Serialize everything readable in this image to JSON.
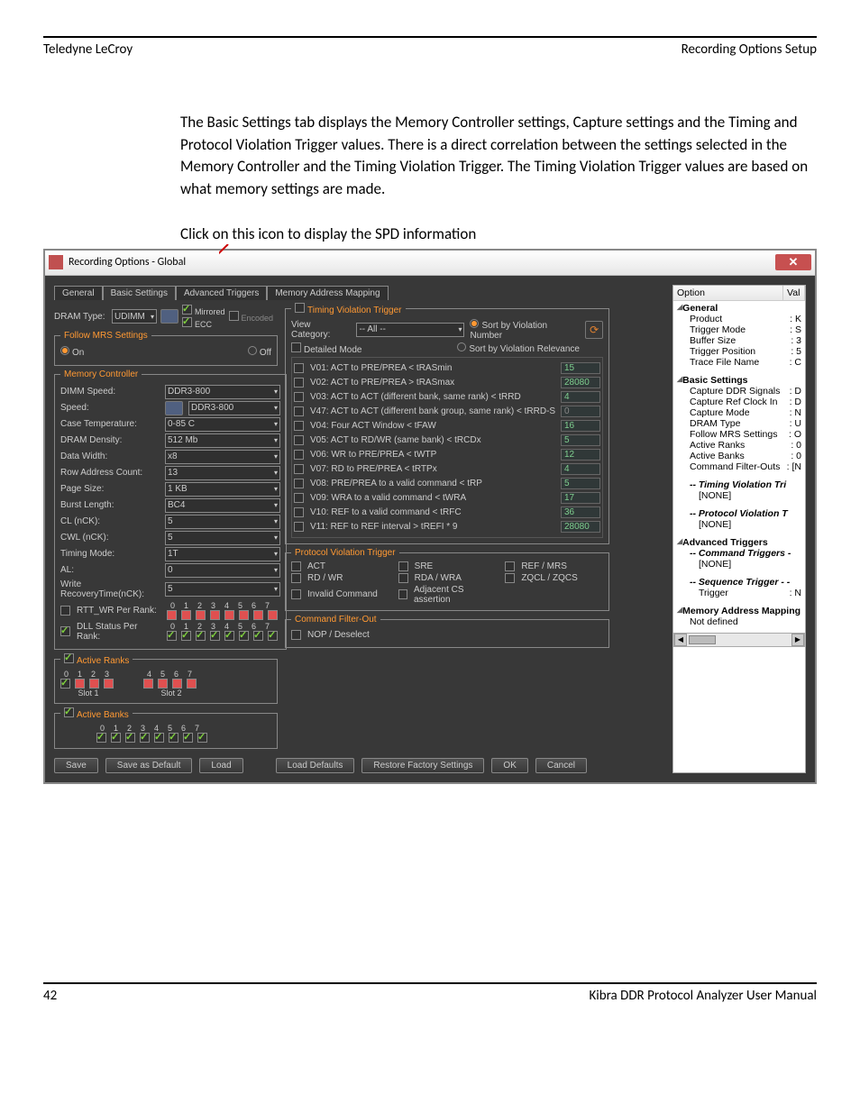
{
  "header": {
    "left": "Teledyne LeCroy",
    "right": "Recording Options Setup"
  },
  "footer": {
    "left": "42",
    "right": "Kibra DDR Protocol Analyzer User Manual"
  },
  "para": "The Basic Settings tab displays the Memory Controller settings, Capture settings and the Timing and Protocol Violation Trigger values. There is a direct correlation between the settings selected in the Memory Controller and the Timing Violation Trigger. The Timing Violation Trigger values are based on what memory settings are made.",
  "caption": "Click on this icon to display the SPD information",
  "window": {
    "title": "Recording Options - Global"
  },
  "tabs": [
    "General",
    "Basic Settings",
    "Advanced Triggers",
    "Memory Address Mapping"
  ],
  "dram": {
    "label": "DRAM Type:",
    "value": "UDIMM",
    "opts": {
      "mirrored": "Mirrored",
      "ecc": "ECC",
      "encoded": "Encoded"
    }
  },
  "mrs": {
    "legend": "Follow MRS Settings",
    "on": "On",
    "off": "Off"
  },
  "mem": {
    "legend": "Memory Controller",
    "fields": [
      {
        "label": "DIMM Speed:",
        "value": "DDR3-800"
      },
      {
        "label": "Speed:",
        "value": "DDR3-800",
        "hasicon": true
      },
      {
        "label": "Case Temperature:",
        "value": "0-85 C"
      },
      {
        "label": "DRAM Density:",
        "value": "512 Mb"
      },
      {
        "label": "Data Width:",
        "value": "x8"
      },
      {
        "label": "Row Address Count:",
        "value": "13"
      },
      {
        "label": "Page Size:",
        "value": "1 KB"
      },
      {
        "label": "Burst Length:",
        "value": "BC4"
      },
      {
        "label": "CL (nCK):",
        "value": "5"
      },
      {
        "label": "CWL (nCK):",
        "value": "5"
      },
      {
        "label": "Timing Mode:",
        "value": "1T"
      },
      {
        "label": "AL:",
        "value": "0"
      },
      {
        "label": "Write RecoveryTime(nCK):",
        "value": "5"
      }
    ],
    "rtt": "RTT_WR Per Rank:",
    "dll": "DLL Status Per Rank:"
  },
  "active_ranks": {
    "legend": "Active Ranks",
    "slot1": "Slot 1",
    "slot2": "Slot 2"
  },
  "active_banks": {
    "legend": "Active Banks"
  },
  "tvt": {
    "legend": "Timing Violation Trigger",
    "view_label": "View Category:",
    "view_value": "-- All --",
    "sort_num": "Sort by Violation Number",
    "sort_rel": "Sort by Violation Relevance",
    "detailed": "Detailed Mode",
    "rows": [
      {
        "name": "V01: ACT to PRE/PREA < tRASmin",
        "val": "15"
      },
      {
        "name": "V02: ACT to PRE/PREA > tRASmax",
        "val": "28080"
      },
      {
        "name": "V03: ACT to ACT (different bank, same rank) < tRRD",
        "val": "4"
      },
      {
        "name": "V47: ACT to ACT (different bank group, same rank) < tRRD-S",
        "val": "0",
        "dis": true
      },
      {
        "name": "V04: Four ACT Window < tFAW",
        "val": "16"
      },
      {
        "name": "V05: ACT to RD/WR (same bank) < tRCDx",
        "val": "5"
      },
      {
        "name": "V06: WR to PRE/PREA < tWTP",
        "val": "12"
      },
      {
        "name": "V07: RD to PRE/PREA < tRTPx",
        "val": "4"
      },
      {
        "name": "V08: PRE/PREA to a valid command < tRP",
        "val": "5"
      },
      {
        "name": "V09: WRA to a valid command < tWRA",
        "val": "17"
      },
      {
        "name": "V10: REF to a valid command < tRFC",
        "val": "36"
      },
      {
        "name": "V11: REF to REF interval > tREFI * 9",
        "val": "28080"
      }
    ]
  },
  "pvt": {
    "legend": "Protocol Violation Trigger",
    "items": [
      "ACT",
      "SRE",
      "REF / MRS",
      "RD / WR",
      "RDA / WRA",
      "ZQCL / ZQCS",
      "Invalid Command",
      "Adjacent CS assertion"
    ]
  },
  "cfo": {
    "legend": "Command Filter-Out",
    "nop": "NOP / Deselect"
  },
  "buttons": {
    "save": "Save",
    "save_def": "Save as Default",
    "load": "Load",
    "load_def": "Load Defaults",
    "restore": "Restore Factory Settings",
    "ok": "OK",
    "cancel": "Cancel"
  },
  "side": {
    "head": {
      "opt": "Option",
      "val": "Val"
    },
    "general": {
      "title": "General",
      "product": "Product",
      "product_v": ": K",
      "tmode": "Trigger Mode",
      "tmode_v": ": S",
      "buf": "Buffer Size",
      "buf_v": ": 3",
      "tpos": "Trigger Position",
      "tpos_v": ": 5",
      "tfile": "Trace File Name",
      "tfile_v": ": C"
    },
    "basic": {
      "title": "Basic Settings",
      "cap_ddr": "Capture DDR Signals",
      "cap_ddr_v": ": D",
      "cap_ref": "Capture Ref Clock In",
      "cap_ref_v": ": D",
      "cap_mode": "Capture Mode",
      "cap_mode_v": ": N",
      "dram": "DRAM Type",
      "dram_v": ": U",
      "follow": "Follow MRS Settings",
      "follow_v": ": O",
      "ar": "Active Ranks",
      "ar_v": ": 0",
      "ab": "Active Banks",
      "ab_v": ": 0",
      "cfo": "Command Filter-Outs",
      "cfo_v": ": [N"
    },
    "tvt": {
      "title": "-- Timing Violation Tri",
      "none": "[NONE]"
    },
    "pvt": {
      "title": "-- Protocol Violation T",
      "none": "[NONE]"
    },
    "adv": {
      "title": "Advanced Triggers",
      "cmd": "-- Command Triggers -",
      "none": "[NONE]",
      "seq": "-- Sequence Trigger - -",
      "trigger": "Trigger",
      "trigger_v": ": N"
    },
    "mam": {
      "title": "Memory Address Mapping",
      "nd": "Not defined"
    }
  }
}
